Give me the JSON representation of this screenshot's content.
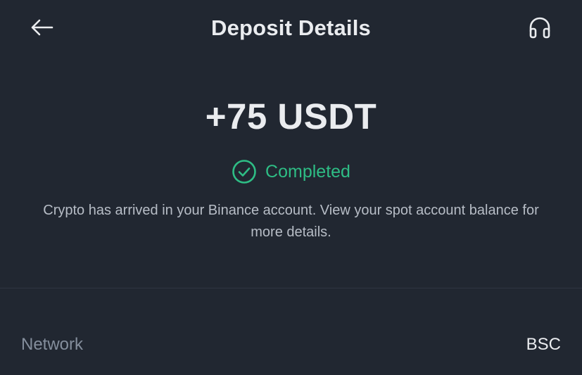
{
  "header": {
    "title": "Deposit Details",
    "back_icon": "arrow-left-icon",
    "support_icon": "headset-icon"
  },
  "deposit": {
    "amount": "+75 USDT",
    "status": "Completed",
    "status_icon": "check-circle-icon",
    "description": "Crypto has arrived in your Binance account. View your spot account balance for more details."
  },
  "details": {
    "network_label": "Network",
    "network_value": "BSC"
  },
  "colors": {
    "background": "#212731",
    "success": "#2ebd85",
    "text_primary": "#eaecef",
    "text_secondary": "#848e9c"
  }
}
